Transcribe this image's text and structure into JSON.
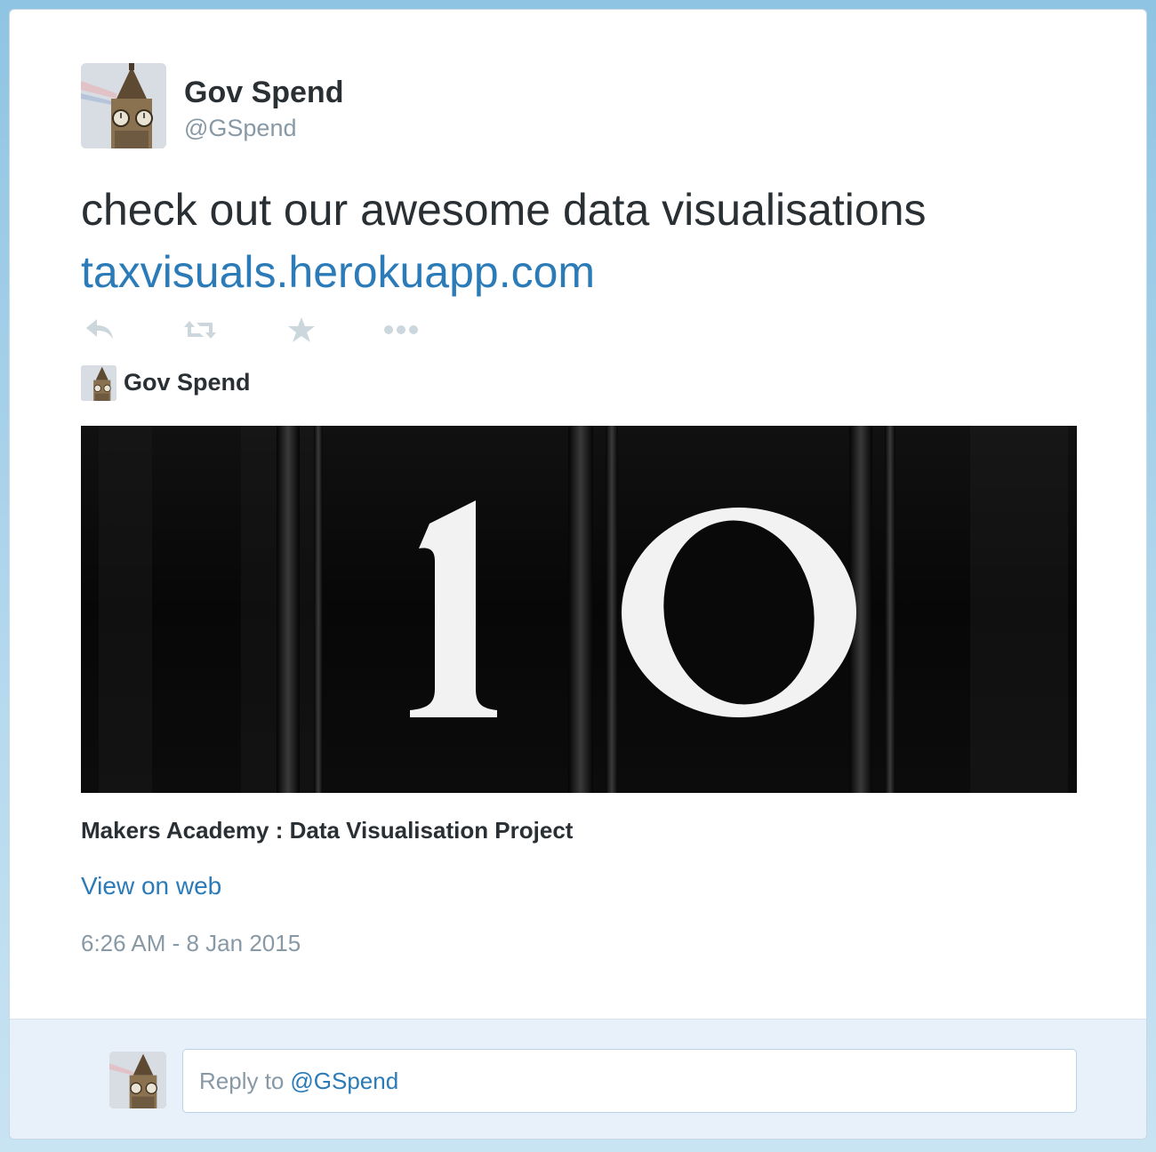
{
  "author": {
    "name": "Gov Spend",
    "handle": "@GSpend",
    "avatar_icon": "big-ben-avatar"
  },
  "tweet": {
    "text": "check out our awesome data visualisations",
    "link": "taxvisuals.herokuapp.com"
  },
  "actions": [
    {
      "name": "reply-icon"
    },
    {
      "name": "retweet-icon"
    },
    {
      "name": "favorite-icon"
    },
    {
      "name": "more-icon"
    }
  ],
  "card": {
    "author_name": "Gov Spend",
    "image_text": "10",
    "title": "Makers Academy : Data Visualisation Project",
    "view_link": "View on web"
  },
  "timestamp": "6:26 AM - 8 Jan 2015",
  "reply": {
    "prefix": "Reply to",
    "mention": "@GSpend"
  },
  "colors": {
    "link": "#2b7bb9",
    "text": "#292f33",
    "muted": "#8899a6",
    "icon": "#ccd6dd",
    "reply_bg": "#e8f1f9"
  }
}
